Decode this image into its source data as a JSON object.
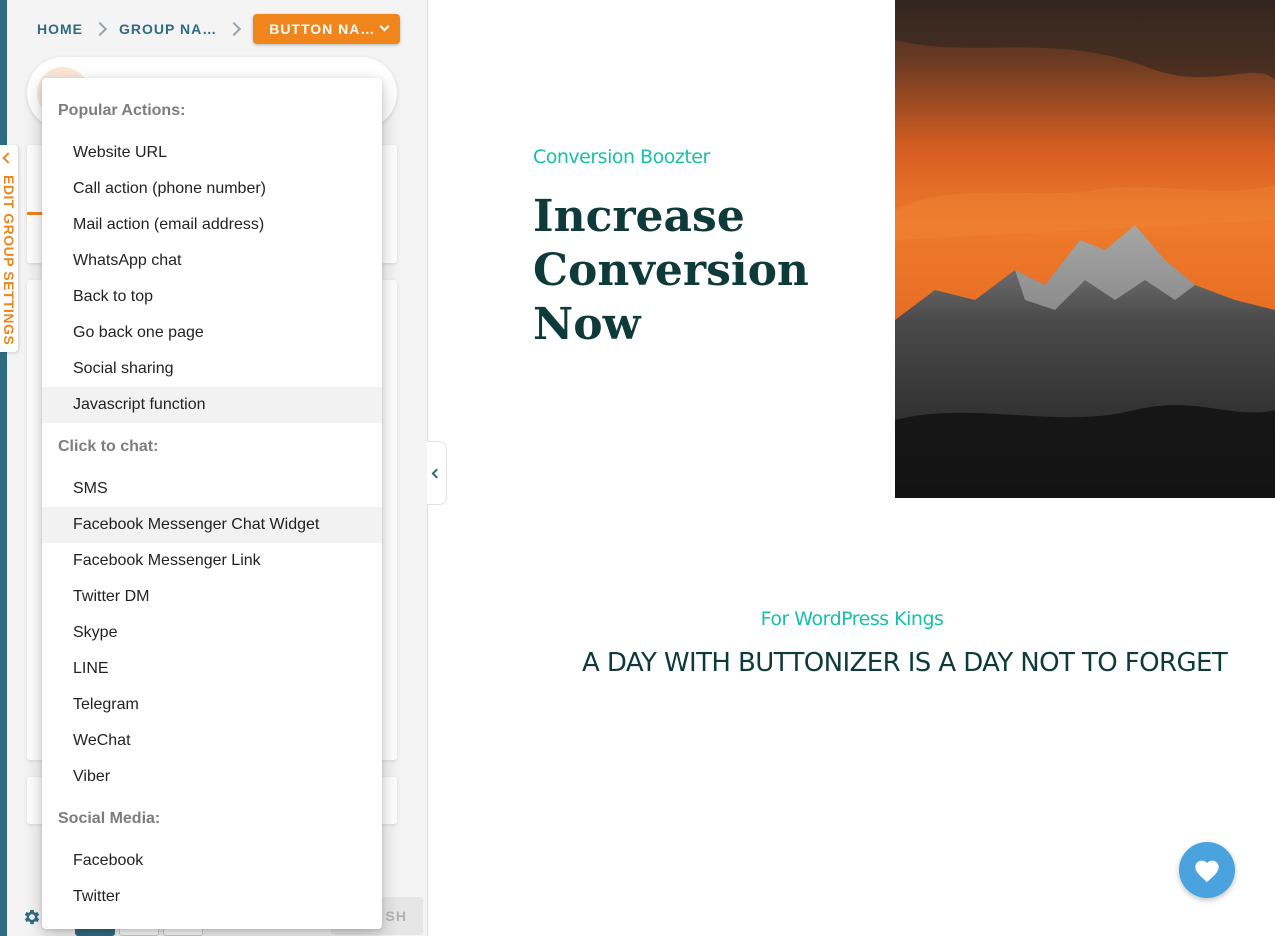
{
  "breadcrumb": {
    "home": "HOME",
    "group": "GROUP NA…",
    "button": "BUTTON NA…"
  },
  "edit_group_tab": "EDIT GROUP SETTINGS",
  "dropdown": {
    "groups": [
      {
        "label": "Popular Actions:",
        "items": [
          "Website URL",
          "Call action (phone number)",
          "Mail action (email address)",
          "WhatsApp chat",
          "Back to top",
          "Go back one page",
          "Social sharing",
          "Javascript function"
        ]
      },
      {
        "label": "Click to chat:",
        "items": [
          "SMS",
          "Facebook Messenger Chat Widget",
          "Facebook Messenger Link",
          "Twitter DM",
          "Skype",
          "LINE",
          "Telegram",
          "WeChat",
          "Viber"
        ]
      },
      {
        "label": "Social Media:",
        "items": [
          "Facebook",
          "Twitter"
        ]
      }
    ],
    "highlighted": [
      "Javascript function",
      "Facebook Messenger Chat Widget"
    ]
  },
  "bottom_bar": {
    "publish_label": "SH"
  },
  "preview": {
    "eyebrow": "Conversion Boozter",
    "hero_title_lines": [
      "Increase",
      "Conversion",
      "Now"
    ],
    "sub_eyebrow": "For WordPress Kings",
    "tagline": "A DAY WITH BUTTONIZER IS A DAY NOT TO FORGET",
    "fab_icon": "heart-icon"
  },
  "colors": {
    "brand_orange": "#f0851c",
    "brand_teal": "#2f6c82",
    "accent_green": "#16c1a8",
    "heading_dark": "#0f3a3a",
    "fab_blue": "#4aa3df"
  }
}
